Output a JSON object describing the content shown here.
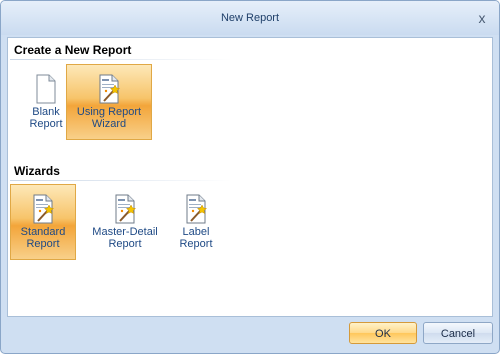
{
  "window": {
    "title": "New Report",
    "close_label": "x"
  },
  "sections": {
    "create": {
      "header": "Create a New Report",
      "items": [
        {
          "label_line1": "Blank",
          "label_line2": "Report",
          "icon": "blank-document-icon",
          "selected": false
        },
        {
          "label_line1": "Using Report",
          "label_line2": "Wizard",
          "icon": "report-wizard-icon",
          "selected": true
        }
      ]
    },
    "wizards": {
      "header": "Wizards",
      "items": [
        {
          "label_line1": "Standard",
          "label_line2": "Report",
          "icon": "report-wizard-icon",
          "selected": true
        },
        {
          "label_line1": "Master-Detail",
          "label_line2": "Report",
          "icon": "report-wizard-icon",
          "selected": false
        },
        {
          "label_line1": "Label",
          "label_line2": "Report",
          "icon": "report-wizard-icon",
          "selected": false
        }
      ]
    }
  },
  "footer": {
    "ok_label": "OK",
    "cancel_label": "Cancel"
  },
  "colors": {
    "selection": "#f7c46a",
    "link_text": "#1f4a85",
    "frame": "#cfdff2"
  }
}
